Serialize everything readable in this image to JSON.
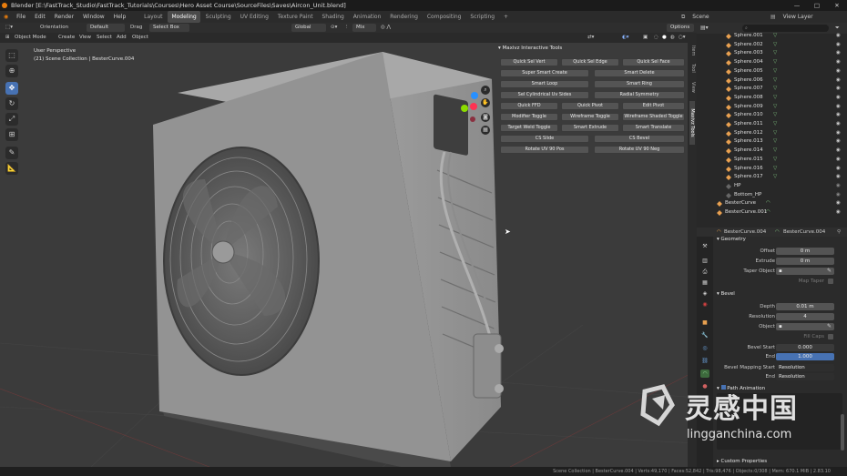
{
  "titlebar": {
    "title": "Blender [E:\\FastTrack_Studio\\FastTrack_Tutorials\\Courses\\Hero Asset Course\\SourceFiles\\Saves\\Aircon_Unit.blend]",
    "minimize": "—",
    "maximize": "□",
    "close": "✕"
  },
  "menu": {
    "items": [
      "File",
      "Edit",
      "Render",
      "Window",
      "Help"
    ],
    "workspaces": [
      "Layout",
      "Modeling",
      "Sculpting",
      "UV Editing",
      "Texture Paint",
      "Shading",
      "Animation",
      "Rendering",
      "Compositing",
      "Scripting"
    ],
    "add_tab": "+",
    "scene_label": "Scene",
    "view_layer_label": "View Layer"
  },
  "header": {
    "orientation_label": "Orientation",
    "orientation_value": "Default",
    "drag_label": "Drag",
    "drag_value": "Select Box",
    "transform_space": "Global",
    "snap_value": "Mix",
    "options_label": "Options",
    "mode": "Object Mode",
    "menus": [
      "Create",
      "View",
      "Select",
      "Add",
      "Object"
    ]
  },
  "viewport": {
    "perspective_label": "User Perspective",
    "collection_label": "(21) Scene Collection | BesterCurve.004",
    "gizmo_axes": [
      "X",
      "Y",
      "Z"
    ],
    "side_tabs": [
      "Item",
      "Tool",
      "View",
      "Maxivz Tools"
    ],
    "colors": {
      "bg": "#3b3b3b",
      "active_tool": "#4772b3",
      "axis_x": "#ff3352",
      "axis_y": "#8bdc00",
      "axis_z": "#2890ff"
    }
  },
  "maxivz": {
    "title": "Maxivz Interactive Tools",
    "rows": [
      [
        "Quick Sel Vert",
        "Quick Sel Edge",
        "Quick Sel Face"
      ],
      [
        "Super Smart Create",
        "Smart Delete"
      ],
      [
        "Smart Loop",
        "Smart Ring"
      ],
      [
        "Sel Cylindrical Uv Sides",
        "Radial Symmetry"
      ],
      [
        "Quick FFD",
        "Quick Pivot",
        "Edit Pivot"
      ],
      [
        "Modifier Toggle",
        "Wireframe Toggle",
        "Wireframe Shaded Toggle"
      ],
      [
        "Target Weld Toggle",
        "Smart Extrude",
        "Smart Translate"
      ],
      [
        "CS Slide",
        "CS Bevel"
      ],
      [
        "Rotate UV 90 Pos",
        "Rotate UV 90 Neg"
      ]
    ]
  },
  "outliner": {
    "search_icon": "search-icon",
    "items": [
      "Sphere.001",
      "Sphere.002",
      "Sphere.003",
      "Sphere.004",
      "Sphere.005",
      "Sphere.006",
      "Sphere.007",
      "Sphere.008",
      "Sphere.009",
      "Sphere.010",
      "Sphere.011",
      "Sphere.012",
      "Sphere.013",
      "Sphere.014",
      "Sphere.015",
      "Sphere.016",
      "Sphere.017"
    ],
    "collections": [
      "HP",
      "Bottom_HP"
    ],
    "curves": [
      "BesterCurve",
      "BesterCurve.001"
    ]
  },
  "properties": {
    "object_name": "BesterCurve.004",
    "data_name": "BesterCurve.004",
    "geometry_section": "Geometry",
    "offset_label": "Offset",
    "offset_value": "0 m",
    "extrude_label": "Extrude",
    "extrude_value": "0 m",
    "taper_label": "Taper Object",
    "map_taper_label": "Map Taper",
    "bevel_section": "Bevel",
    "depth_label": "Depth",
    "depth_value": "0.01 m",
    "resolution_label": "Resolution",
    "resolution_value": "4",
    "object_label": "Object",
    "fill_caps_label": "Fill Caps",
    "bevel_start_label": "Bevel Start",
    "bevel_start_value": "0.000",
    "end_label": "End",
    "end_value": "1.000",
    "mapping_start_label": "Bevel Mapping Start",
    "mapping_start_value": "Resolution",
    "mapping_end_label": "End",
    "mapping_end_value": "Resolution",
    "path_animation": "Path Animation",
    "custom_properties": "Custom Properties"
  },
  "status": {
    "text": "Scene Collection | BesterCurve.004 | Verts:49,170 | Faces:52,842 | Tris:98,476 | Objects:0/308 | Mem: 670.1 MiB | 2.83.10"
  },
  "watermark": {
    "brand": "灵感中国",
    "url": "lingganchina.com"
  }
}
